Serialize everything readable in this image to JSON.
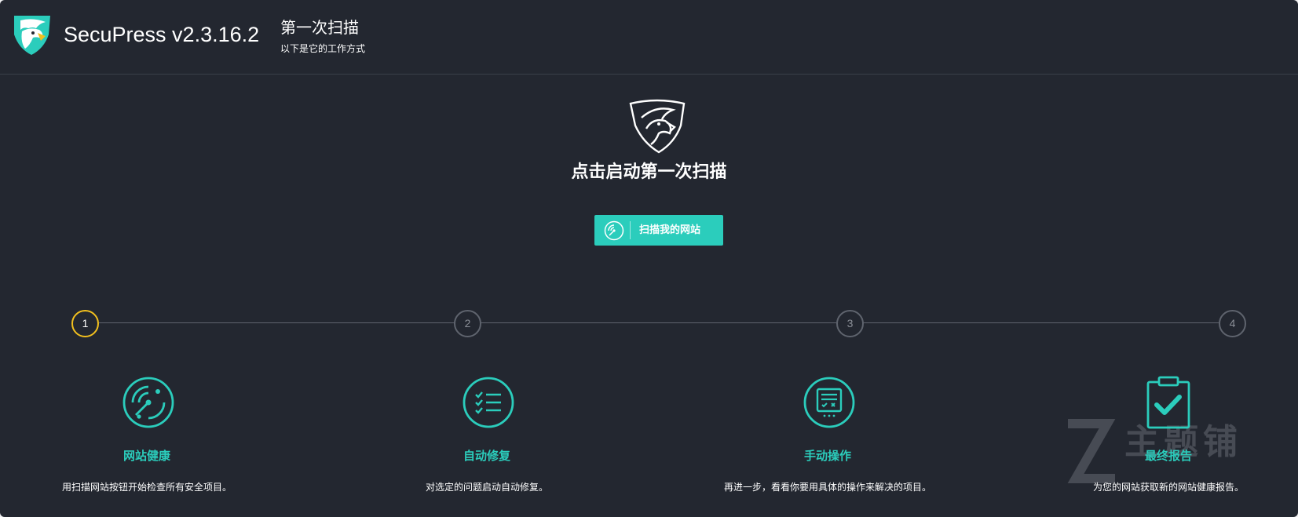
{
  "header": {
    "app_title": "SecuPress v2.3.16.2",
    "scan_title": "第一次扫描",
    "scan_subtitle": "以下是它的工作方式"
  },
  "hero": {
    "heading": "点击启动第一次扫描",
    "button_label": "扫描我的网站"
  },
  "steps": [
    {
      "number": "1",
      "active": true
    },
    {
      "number": "2",
      "active": false
    },
    {
      "number": "3",
      "active": false
    },
    {
      "number": "4",
      "active": false
    }
  ],
  "features": [
    {
      "icon": "radar-icon",
      "title": "网站健康",
      "description": "用扫描网站按钮开始检查所有安全项目。"
    },
    {
      "icon": "checklist-icon",
      "title": "自动修复",
      "description": "对选定的问题启动自动修复。"
    },
    {
      "icon": "manual-task-icon",
      "title": "手动操作",
      "description": "再进一步，看看你要用具体的操作来解决的项目。"
    },
    {
      "icon": "clipboard-check-icon",
      "title": "最终报告",
      "description": "为您的网站获取新的网站健康报告。"
    }
  ],
  "watermark": {
    "text": "主题铺"
  },
  "colors": {
    "background": "#232730",
    "accent": "#2bcdbc",
    "active_step": "#f2c01e",
    "step_inactive": "#5f646e"
  }
}
